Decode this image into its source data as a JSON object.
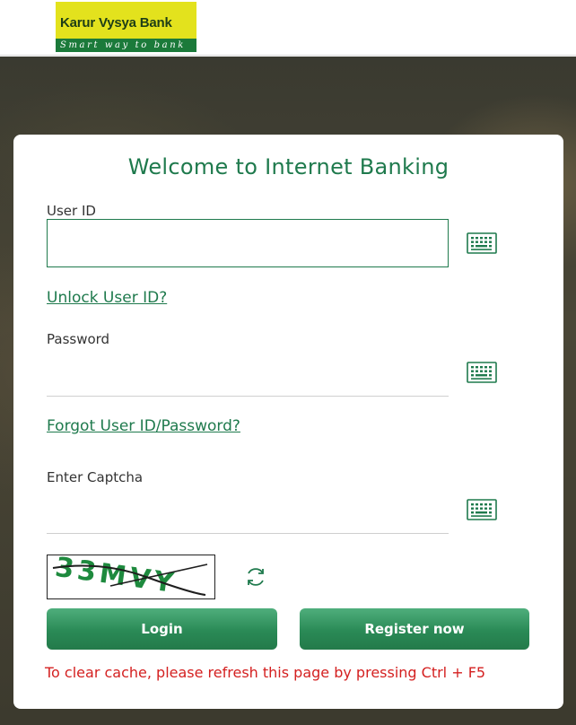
{
  "header": {
    "brand_name": "Karur Vysya Bank",
    "tagline": "Smart way to bank",
    "brand_colors": {
      "yellow": "#e3e21d",
      "green": "#1b7a3a"
    }
  },
  "login": {
    "title": "Welcome to Internet Banking",
    "userid_label": "User ID",
    "userid_value": "",
    "unlock_link": "Unlock User ID?",
    "password_label": "Password",
    "password_value": "",
    "forgot_link": "Forgot User ID/Password?",
    "captcha_label": "Enter Captcha",
    "captcha_value": "",
    "captcha_text": "33MVY",
    "login_button": "Login",
    "register_button": "Register now",
    "cache_note": "To clear cache, please refresh this page by pressing Ctrl + F5"
  },
  "icons": {
    "keyboard": "virtual-keyboard-icon",
    "refresh": "refresh-captcha-icon"
  },
  "colors": {
    "accent": "#1f7a4d",
    "button": "#2a8a56",
    "warning": "#d42020"
  }
}
